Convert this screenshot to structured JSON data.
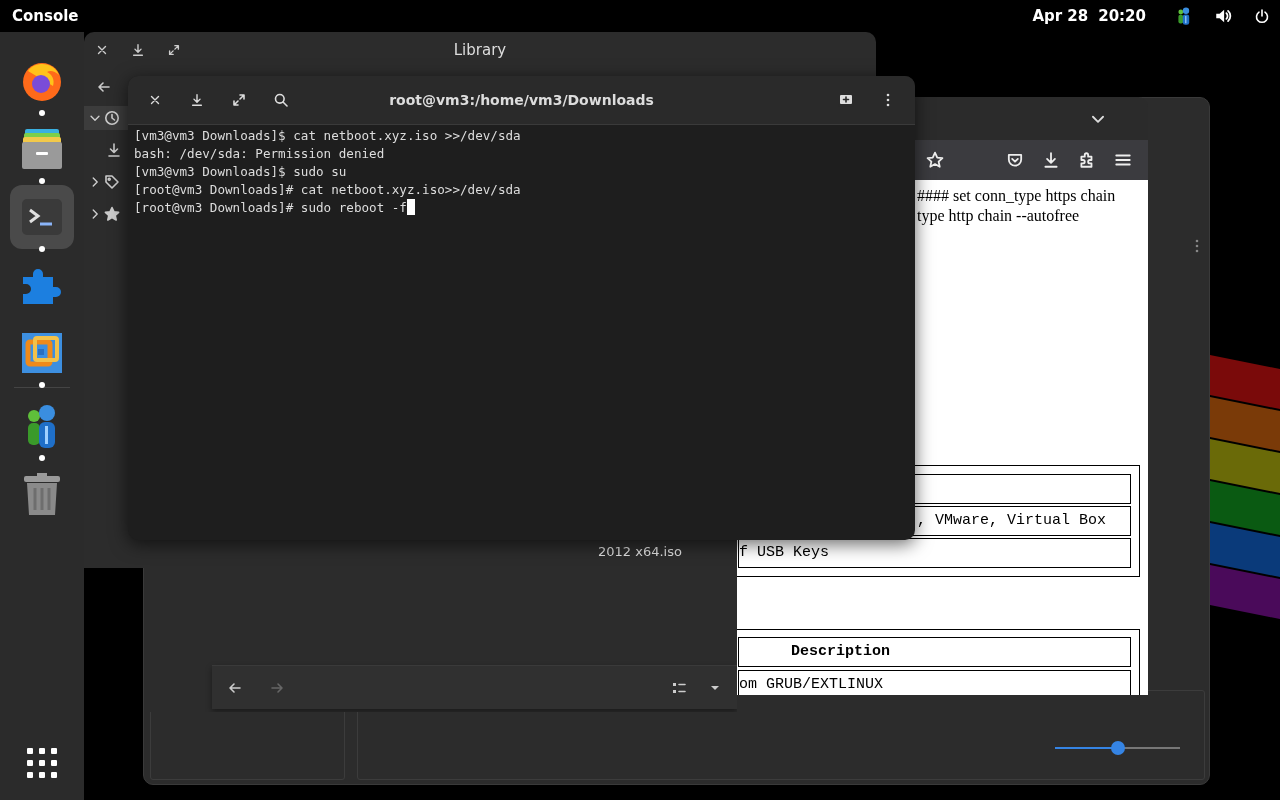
{
  "top_bar": {
    "app_name": "Console",
    "date": "Apr 28",
    "time": "20:20"
  },
  "dock": {
    "items": [
      {
        "kind": "firefox",
        "running": true,
        "selected": false
      },
      {
        "kind": "files",
        "running": true,
        "selected": false
      },
      {
        "kind": "terminal",
        "running": true,
        "selected": true
      },
      {
        "kind": "extensions",
        "running": false,
        "selected": false
      },
      {
        "kind": "boxes",
        "running": true,
        "selected": false
      },
      {
        "kind": "divider"
      },
      {
        "kind": "people",
        "running": true,
        "selected": false
      },
      {
        "kind": "trash",
        "running": false,
        "selected": false
      }
    ]
  },
  "viewer": {
    "zoom_slider": {
      "level": 0.5
    }
  },
  "browser": {
    "text_lines": [
      "#### set conn_type https chain",
      "type http chain --autofree"
    ],
    "table_1": {
      "rows": [
        ", VMware, Virtual Box",
        "f USB Keys"
      ]
    },
    "table_2": {
      "header": "Description",
      "rows": [
        "om GRUB/EXTLINUX"
      ]
    }
  },
  "files_panel": {
    "file_name": "2012 x64.iso"
  },
  "library": {
    "title": "Library",
    "sidebar": [
      {
        "kind": "recent",
        "expanded": true,
        "selected": true
      },
      {
        "kind": "downloads",
        "selected": false
      },
      {
        "kind": "tags",
        "expanded": false,
        "selected": false
      },
      {
        "kind": "starred",
        "expanded": false,
        "selected": false
      }
    ]
  },
  "terminal": {
    "title": "root@vm3:/home/vm3/Downloads",
    "cursor": true,
    "lines": [
      "[vm3@vm3 Downloads]$ cat netboot.xyz.iso >>/dev/sda",
      "bash: /dev/sda: Permission denied",
      "[vm3@vm3 Downloads]$ sudo su",
      "[root@vm3 Downloads]# cat netboot.xyz.iso>>/dev/sda",
      "[root@vm3 Downloads]# sudo reboot -f"
    ]
  }
}
